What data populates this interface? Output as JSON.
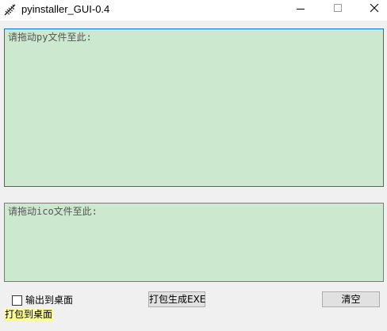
{
  "window": {
    "title": "pyinstaller_GUI-0.4",
    "app_icon": "feather-pen-icon",
    "controls": [
      "minimize-icon",
      "maximize-icon",
      "close-icon"
    ]
  },
  "py_input": {
    "placeholder": "请拖动py文件至此:",
    "value": ""
  },
  "ico_input": {
    "placeholder": "请拖动ico文件至此:",
    "value": ""
  },
  "options": {
    "output_to_desktop_label": "输出到桌面",
    "output_to_desktop_checked": false
  },
  "buttons": {
    "build_label": "打包生成EXE",
    "clear_label": "清空"
  },
  "status": {
    "text": "打包到桌面"
  },
  "colors": {
    "textarea_bg": "#cce8cf",
    "focus_border": "#0078d7",
    "status_bg": "#ffff99"
  }
}
